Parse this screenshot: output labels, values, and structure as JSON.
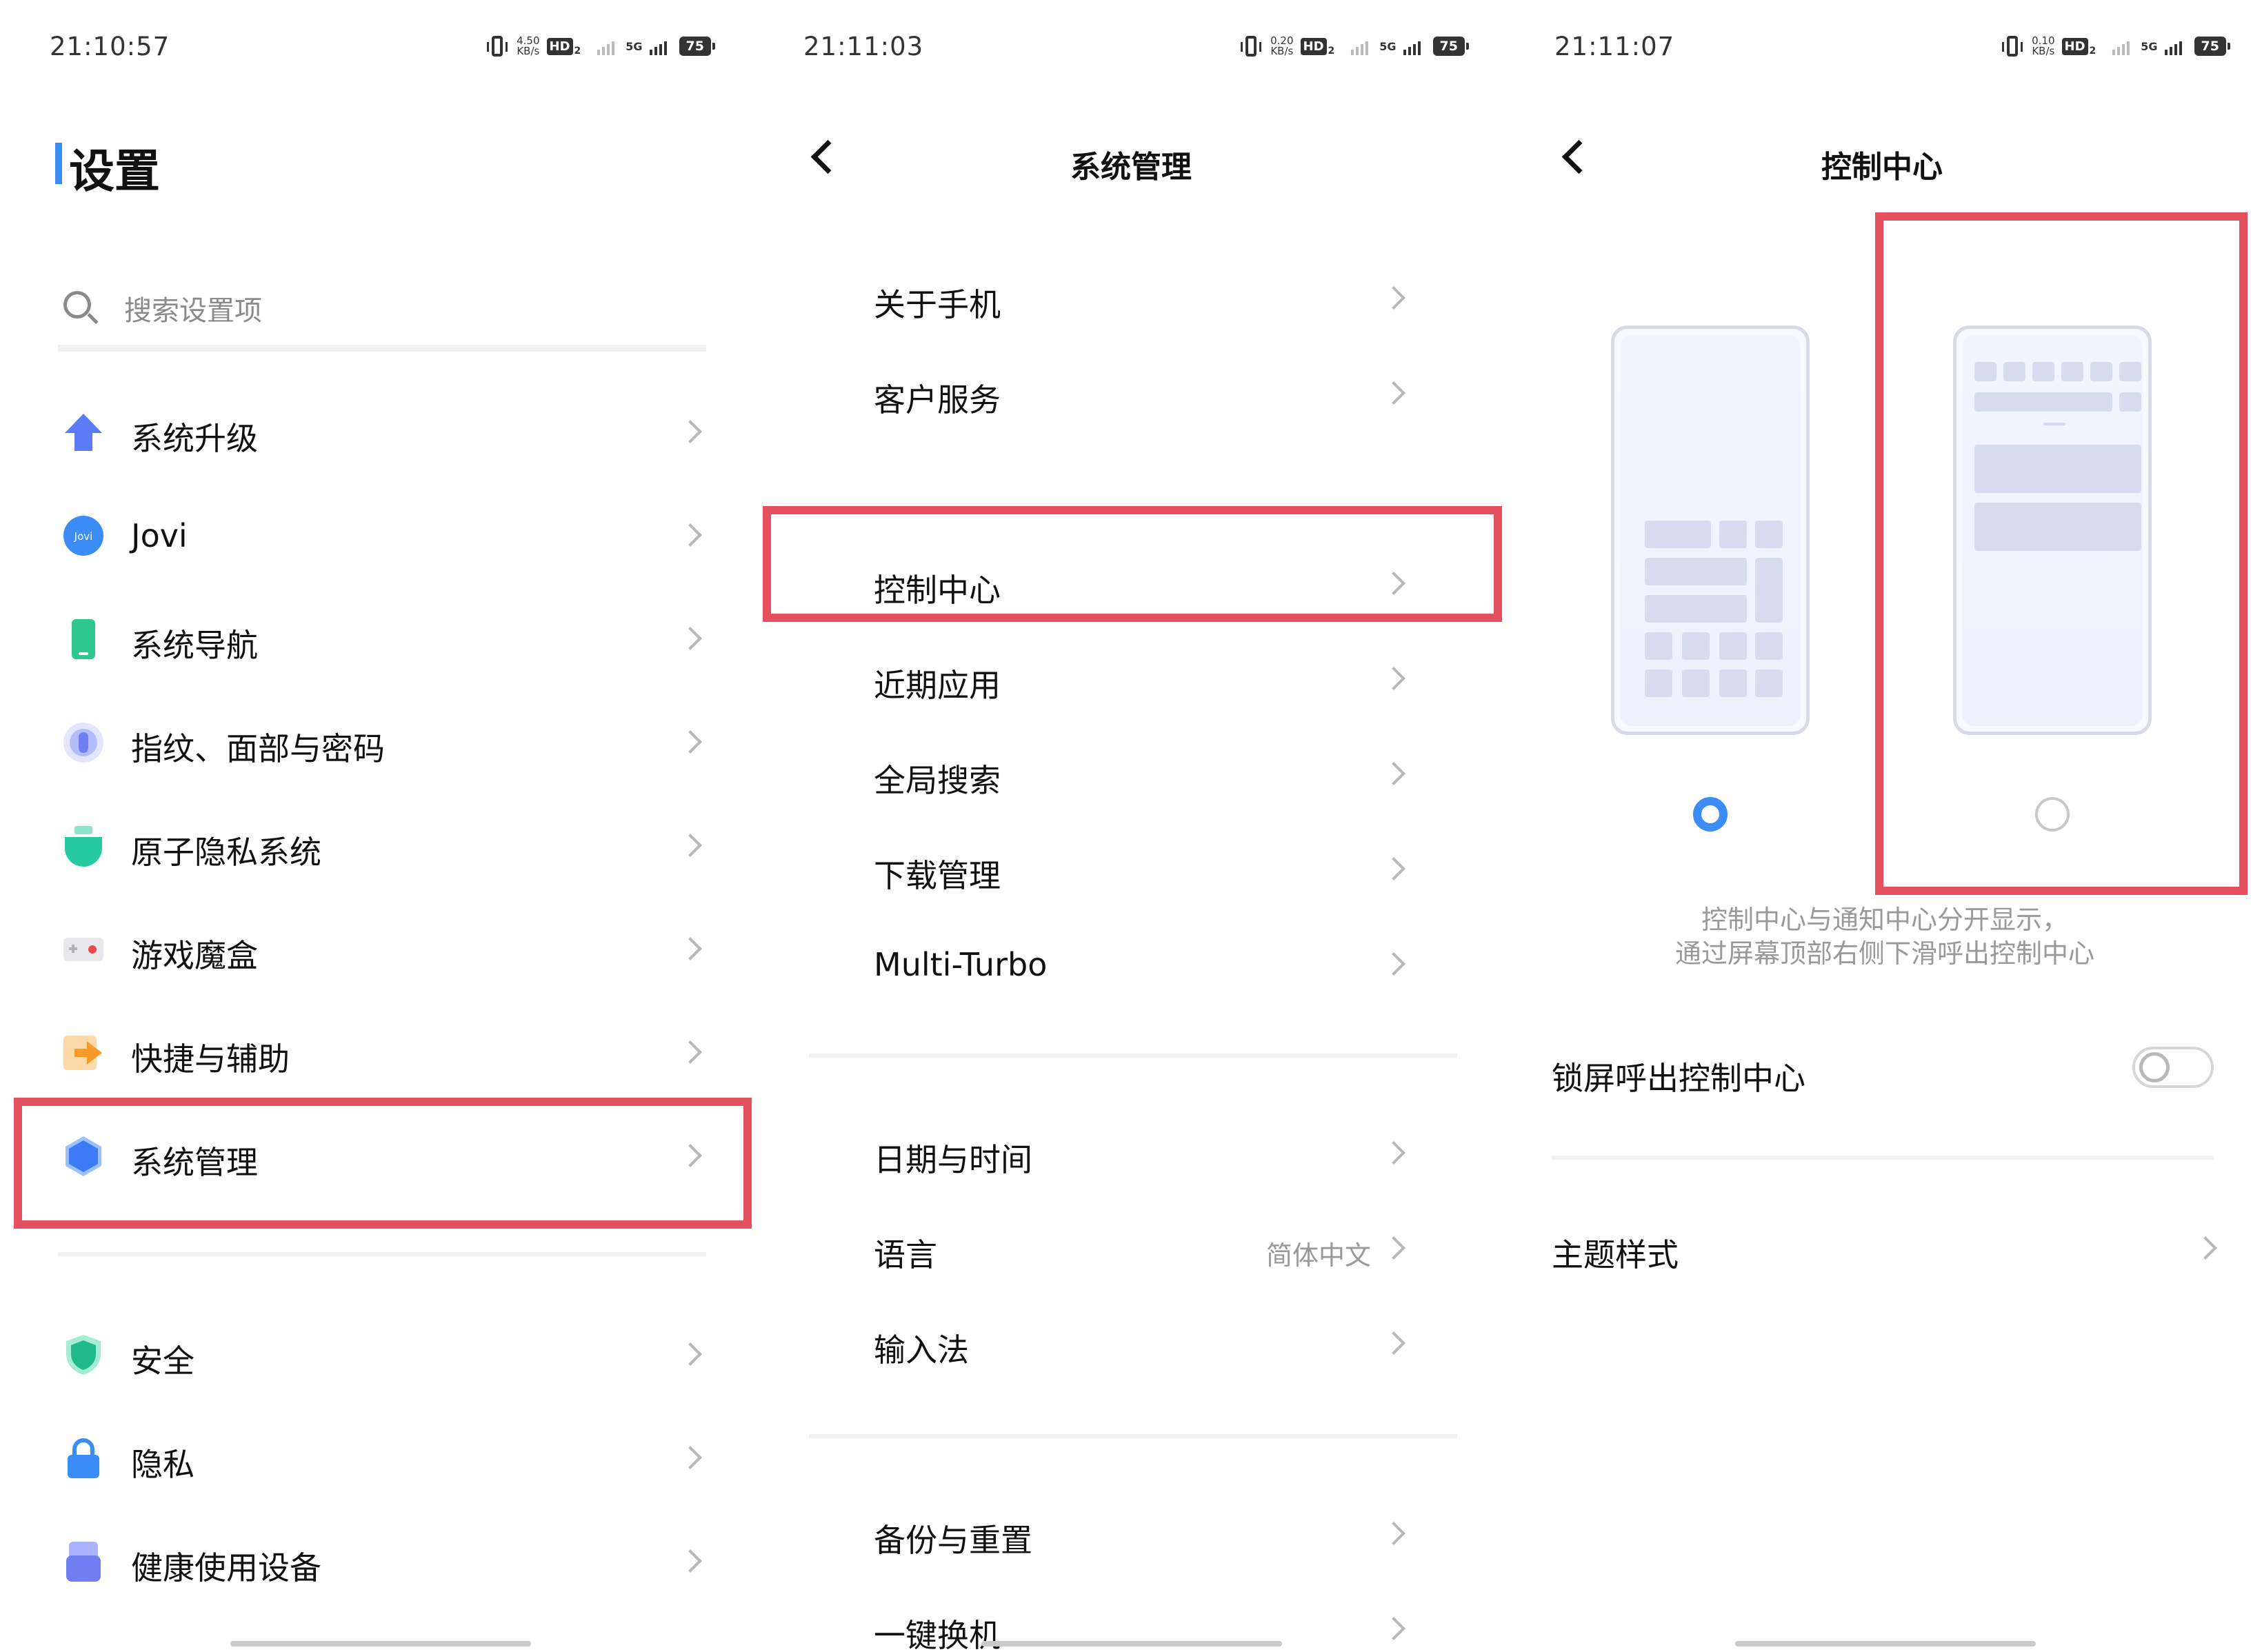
{
  "panel1": {
    "status": {
      "time": "21:10:57",
      "speed_value": "4.50",
      "speed_unit": "KB/s",
      "hd": "HD",
      "hd_sub": "2",
      "network": "5G",
      "battery": "75"
    },
    "title": "设置",
    "search_placeholder": "搜索设置项",
    "items_group1": [
      {
        "label": "系统升级",
        "icon": "system-upgrade-icon",
        "color": "#5b7cf6"
      },
      {
        "label": "Jovi",
        "icon": "jovi-icon",
        "color": "#3c8cf5"
      },
      {
        "label": "系统导航",
        "icon": "navigation-icon",
        "color": "#2ec88e"
      },
      {
        "label": "指纹、面部与密码",
        "icon": "fingerprint-icon",
        "color": "#6f7ff2"
      },
      {
        "label": "原子隐私系统",
        "icon": "atom-privacy-icon",
        "color": "#27c9a0"
      },
      {
        "label": "游戏魔盒",
        "icon": "game-box-icon",
        "color": "#e8484e"
      },
      {
        "label": "快捷与辅助",
        "icon": "shortcut-icon",
        "color": "#f89a2a"
      },
      {
        "label": "系统管理",
        "icon": "system-management-icon",
        "color": "#3c7bf5"
      }
    ],
    "items_group2": [
      {
        "label": "安全",
        "icon": "security-shield-icon",
        "color": "#1fb98a"
      },
      {
        "label": "隐私",
        "icon": "privacy-lock-icon",
        "color": "#3c8cf5"
      },
      {
        "label": "健康使用设备",
        "icon": "health-usage-icon",
        "color": "#6f7ff2"
      }
    ]
  },
  "panel2": {
    "status": {
      "time": "21:11:03",
      "speed_value": "0.20",
      "speed_unit": "KB/s",
      "hd": "HD",
      "hd_sub": "2",
      "network": "5G",
      "battery": "75"
    },
    "title": "系统管理",
    "group1": [
      "关于手机",
      "客户服务"
    ],
    "group2": [
      "控制中心",
      "近期应用",
      "全局搜索",
      "下载管理",
      "Multi-Turbo"
    ],
    "group3": [
      {
        "label": "日期与时间",
        "value": ""
      },
      {
        "label": "语言",
        "value": "简体中文"
      },
      {
        "label": "输入法",
        "value": ""
      }
    ],
    "group4": [
      "备份与重置",
      "一键换机"
    ]
  },
  "panel3": {
    "status": {
      "time": "21:11:07",
      "speed_value": "0.10",
      "speed_unit": "KB/s",
      "hd": "HD",
      "hd_sub": "2",
      "network": "5G",
      "battery": "75"
    },
    "title": "控制中心",
    "style_options": {
      "selected_index": 0
    },
    "description_line1": "控制中心与通知中心分开显示，",
    "description_line2": "通过屏幕顶部右侧下滑呼出控制中心",
    "lockscreen_toggle_label": "锁屏呼出控制中心",
    "lockscreen_toggle_on": false,
    "theme_style_label": "主题样式"
  },
  "colors": {
    "accent": "#3c8cf5",
    "highlight_border": "#e5505f"
  }
}
